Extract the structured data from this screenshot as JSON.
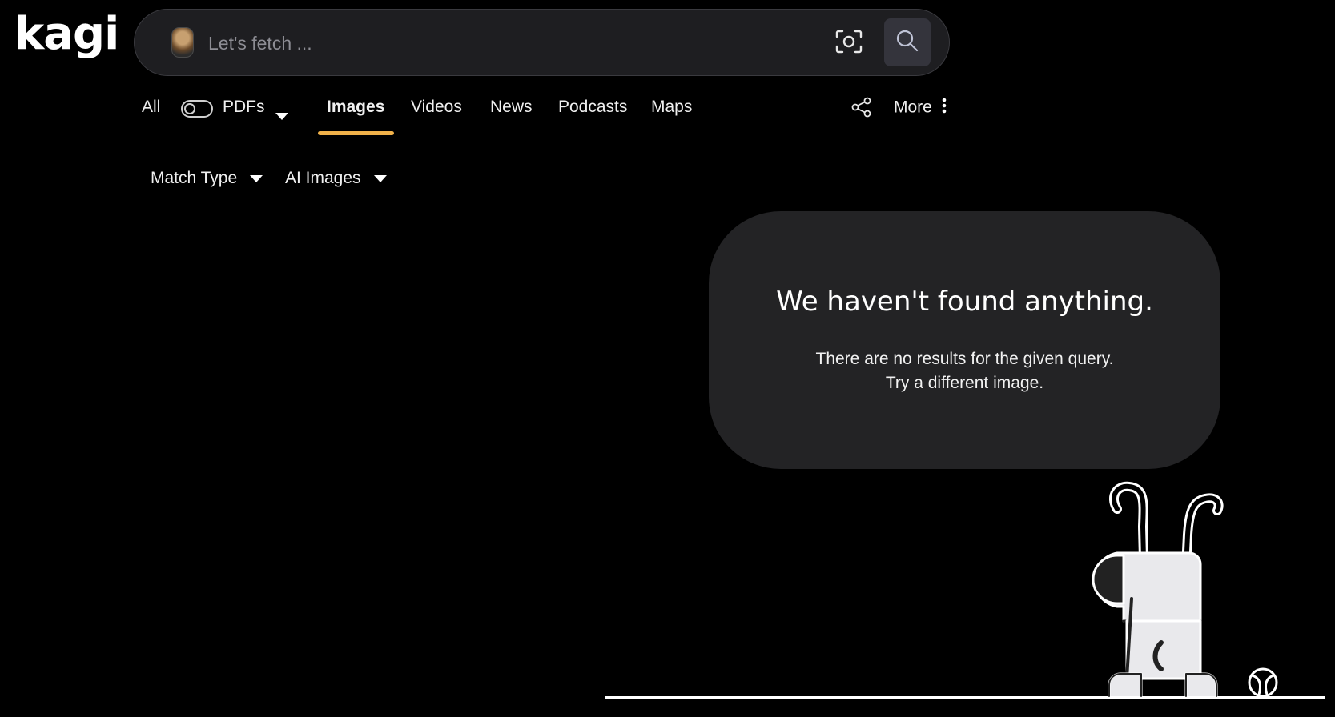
{
  "header": {
    "logo_text": "kagi",
    "search": {
      "placeholder": "Let's fetch ...",
      "value": ""
    },
    "camera_icon": "camera-scan-icon",
    "search_icon": "magnifier-icon"
  },
  "nav": {
    "all_label": "All",
    "pdfs_label": "PDFs",
    "tabs": [
      {
        "label": "Images",
        "active": true
      },
      {
        "label": "Videos",
        "active": false
      },
      {
        "label": "News",
        "active": false
      },
      {
        "label": "Podcasts",
        "active": false
      },
      {
        "label": "Maps",
        "active": false
      }
    ],
    "share_icon": "share-icon",
    "more_label": "More"
  },
  "filters": {
    "match_type_label": "Match Type",
    "ai_images_label": "AI Images"
  },
  "empty_state": {
    "title": "We haven't found anything.",
    "line1": "There are no results for the given query.",
    "line2": "Try a different image."
  },
  "colors": {
    "background": "#000000",
    "card": "#232325",
    "accent_underline": "#f1b24a",
    "search_button": "#34343c"
  }
}
